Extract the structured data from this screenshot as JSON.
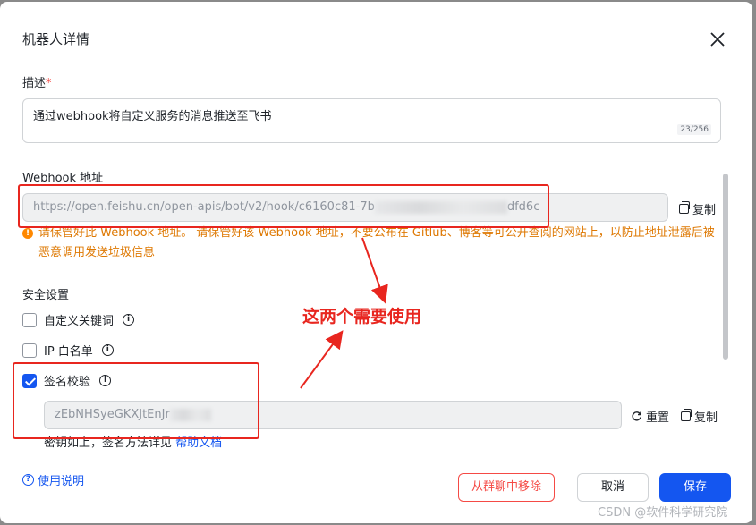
{
  "dialog": {
    "title": "机器人详情"
  },
  "description": {
    "label": "描述",
    "required_mark": "*",
    "value": "通过webhook将自定义服务的消息推送至飞书",
    "counter": "23/256"
  },
  "webhook": {
    "label": "Webhook 地址",
    "value_prefix": "https://open.feishu.cn/open-apis/bot/v2/hook/c6160c81-7b",
    "value_suffix": "dfd6c",
    "copy_label": "复制",
    "warning": "请保管好此 Webhook 地址。 请保管好该 Webhook 地址，不要公布在 Gitlub、博客等可公开查阅的网站上，以防止地址泄露后被恶意调用发送垃圾信息"
  },
  "security": {
    "label": "安全设置",
    "options": [
      {
        "label": "自定义关键词",
        "checked": false
      },
      {
        "label": "IP 白名单",
        "checked": false
      },
      {
        "label": "签名校验",
        "checked": true
      }
    ],
    "secret_prefix": "zEbNHSyeGKXJtEnJr",
    "reset_label": "重置",
    "copy_label": "复制",
    "hint_text": "密钥如上，签名方法详见",
    "hint_link": "帮助文档"
  },
  "footer": {
    "help": "使用说明",
    "remove_button": "从群聊中移除",
    "cancel_button": "取消",
    "save_button": "保存"
  },
  "annotation": {
    "text": "这两个需要使用",
    "color": "#e8261f"
  },
  "watermark": "CSDN @软件科学研究院",
  "colors": {
    "primary": "#1456f0",
    "danger": "#f54a45",
    "warning": "#de7802"
  }
}
